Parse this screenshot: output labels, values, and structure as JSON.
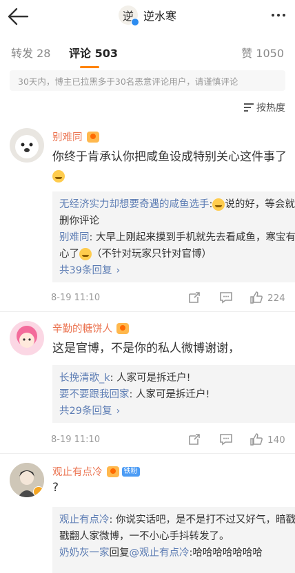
{
  "header": {
    "title": "逆水寒",
    "avatar_glyph": "逆"
  },
  "tabs": [
    {
      "label": "转发 28"
    },
    {
      "label": "评论 503"
    },
    {
      "label": "赞 1050"
    }
  ],
  "notice": "30天内，博主已拉黑多于30名恶意评论用户，请谨慎评论",
  "sort_label": "按热度",
  "comments": [
    {
      "name": "别难同",
      "text_a": "你终于肯承认你把咸鱼设成特别关心这件事",
      "text_b": "了",
      "replies": [
        {
          "name": "无经济实力却想要奇遇的咸鱼选手",
          "text_a": ":",
          "text_b": "说的好，等会就删你评论"
        },
        {
          "name": "别难同",
          "text_a": ": 大早上刚起来摸到手机就先去看咸鱼，寒宝有心了",
          "text_b": "（不针对玩家只针对官博）"
        }
      ],
      "more": "共39条回复",
      "date": "8-19 11:10",
      "likes": "224"
    },
    {
      "name": "辛勤的糖饼人",
      "text_a": "这是官博，不是你的私人微博谢谢，",
      "replies": [
        {
          "name": "长挽清歌_k",
          "text_a": ": 人家可是拆迁户!"
        },
        {
          "name": "要不要跟我回家",
          "text_a": ": 人家可是拆迁户!"
        }
      ],
      "more": "共29条回复",
      "date": "8-19 11:10",
      "likes": "140"
    },
    {
      "name": "观止有点冷",
      "badge": "铁粉",
      "text_a": "?",
      "replies": [
        {
          "name": "观止有点冷",
          "text_a": ": 你说实话吧，是不是打不过又好气，暗戳戳翻人家微博，一不小心手抖转发了。"
        },
        {
          "name": "奶奶灰一家",
          "text_a": "回复",
          "mention": "@观止有点冷",
          "text_b": ":哈哈哈哈哈哈哈"
        }
      ]
    }
  ],
  "colors": {
    "accent": "#ff8200",
    "username": "#eb7350",
    "reply_name": "#5d7db4"
  }
}
